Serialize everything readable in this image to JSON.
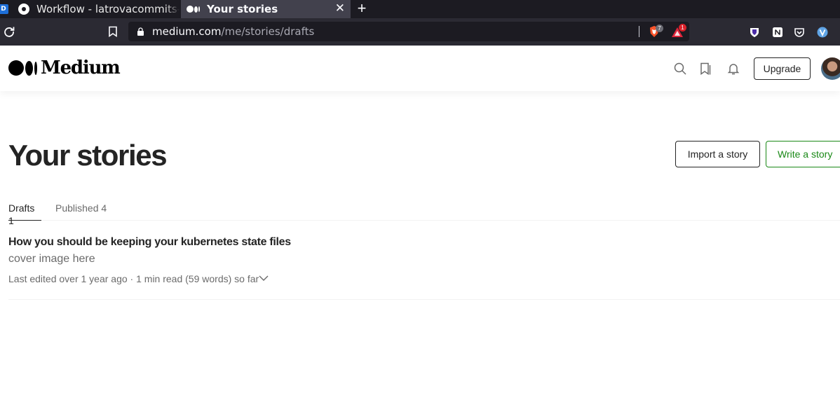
{
  "browser": {
    "tabs": [
      {
        "title": "Workflow - latrovacommits-ar",
        "active": false
      },
      {
        "title": "Your stories",
        "active": true
      }
    ],
    "url": {
      "host": "medium.com",
      "path": "/me/stories/drafts"
    },
    "shield_count": "7",
    "rewards_count": "1",
    "icons": {
      "reload": "reload-icon",
      "bookmark": "bookmark-icon",
      "lock": "lock-icon",
      "close": "close-icon",
      "new_tab": "plus-icon"
    }
  },
  "header": {
    "logo_text": "Medium",
    "upgrade_label": "Upgrade",
    "icons": [
      "search-icon",
      "bookmarks-icon",
      "bell-icon"
    ]
  },
  "page": {
    "title": "Your stories",
    "import_label": "Import a story",
    "write_label": "Write a story",
    "tabs": [
      {
        "label": "Drafts 1",
        "active": true
      },
      {
        "label": "Published 4",
        "active": false
      }
    ]
  },
  "stories": [
    {
      "title": "How you should be keeping your kubernetes state files",
      "subtitle": "cover image here",
      "meta": "Last edited over 1 year ago · 1 min read (59 words) so far"
    }
  ],
  "colors": {
    "text": "#242424",
    "muted": "#6b6b6b",
    "accent_green": "#1a8917",
    "chrome_dark": "#1c1b22",
    "chrome_bar": "#2b2a33"
  }
}
